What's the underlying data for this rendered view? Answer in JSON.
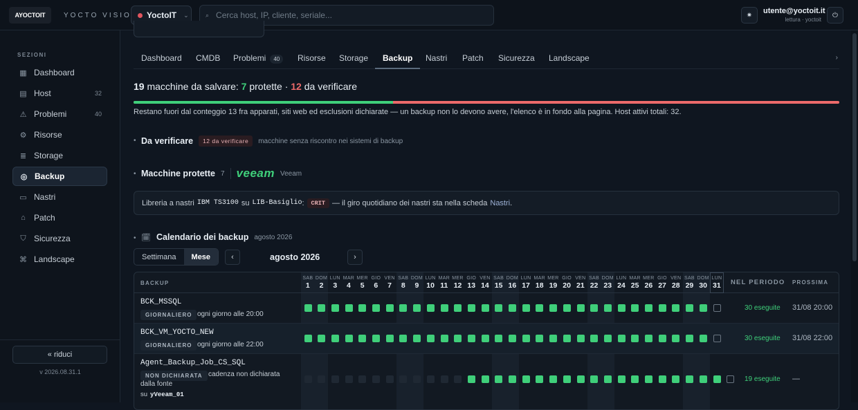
{
  "topbar": {
    "logo_text": "AYOCTOIT",
    "brand": "YOCTO VISION",
    "tenant": "YoctoIT",
    "search_placeholder": "Cerca host, IP, cliente, seriale...",
    "user_email": "utente@yoctoit.it",
    "user_role": "lettura · yoctoit"
  },
  "sidebar": {
    "section_label": "SEZIONI",
    "items": [
      {
        "label": "Dashboard",
        "icon": "grid-icon",
        "count": ""
      },
      {
        "label": "Host",
        "icon": "server-icon",
        "count": "32"
      },
      {
        "label": "Problemi",
        "icon": "warning-icon",
        "count": "40"
      },
      {
        "label": "Risorse",
        "icon": "cpu-icon",
        "count": ""
      },
      {
        "label": "Storage",
        "icon": "database-icon",
        "count": ""
      },
      {
        "label": "Backup",
        "icon": "backup-icon",
        "count": "",
        "active": true
      },
      {
        "label": "Nastri",
        "icon": "tape-icon",
        "count": ""
      },
      {
        "label": "Patch",
        "icon": "patch-icon",
        "count": ""
      },
      {
        "label": "Sicurezza",
        "icon": "shield-icon",
        "count": ""
      },
      {
        "label": "Landscape",
        "icon": "network-icon",
        "count": ""
      }
    ],
    "reduce_label": "« riduci",
    "version": "v 2026.08.31.1"
  },
  "tabs": [
    {
      "label": "Dashboard",
      "badge": ""
    },
    {
      "label": "CMDB",
      "badge": ""
    },
    {
      "label": "Problemi",
      "badge": "40"
    },
    {
      "label": "Risorse",
      "badge": ""
    },
    {
      "label": "Storage",
      "badge": ""
    },
    {
      "label": "Backup",
      "badge": "",
      "active": true
    },
    {
      "label": "Nastri",
      "badge": ""
    },
    {
      "label": "Patch",
      "badge": ""
    },
    {
      "label": "Sicurezza",
      "badge": ""
    },
    {
      "label": "Landscape",
      "badge": ""
    }
  ],
  "summary": {
    "to_save_count": "19",
    "to_save_text": "macchine da salvare:",
    "protected_count": "7",
    "protected_text": "protette ·",
    "verify_count": "12",
    "verify_text": "da verificare",
    "protected_fraction": 0.368,
    "note": "Restano fuori dal conteggio 13 fra apparati, siti web ed esclusioni dichiarate — un backup non lo devono avere, l'elenco è in fondo alla pagina. Host attivi totali: 32."
  },
  "verify_section": {
    "title": "Da verificare",
    "badge": "12 da verificare",
    "desc": "macchine senza riscontro nei sistemi di backup"
  },
  "protected_section": {
    "title": "Macchine protette",
    "count": "7",
    "vendor_logo": "veeam",
    "vendor": "Veeam"
  },
  "tape_info": {
    "prefix": "Libreria a nastri",
    "model": "IBM TS3100",
    "on": "su",
    "host": "LIB-Basiglio",
    "colon": ":",
    "status": "CRIT",
    "suffix": "— il giro quotidiano dei nastri sta nella scheda",
    "link": "Nastri",
    "end": "."
  },
  "calendar": {
    "title": "Calendario dei backup",
    "subtitle": "agosto 2026",
    "view_week": "Settimana",
    "view_month": "Mese",
    "prev": "‹",
    "next": "›",
    "month_label": "agosto 2026",
    "col_backup": "BACKUP",
    "col_period": "NEL PERIODO",
    "col_next": "PROSSIMA",
    "days": [
      {
        "d": "SAB",
        "n": "1"
      },
      {
        "d": "DOM",
        "n": "2"
      },
      {
        "d": "LUN",
        "n": "3"
      },
      {
        "d": "MAR",
        "n": "4"
      },
      {
        "d": "MER",
        "n": "5"
      },
      {
        "d": "GIO",
        "n": "6"
      },
      {
        "d": "VEN",
        "n": "7"
      },
      {
        "d": "SAB",
        "n": "8"
      },
      {
        "d": "DOM",
        "n": "9"
      },
      {
        "d": "LUN",
        "n": "10"
      },
      {
        "d": "MAR",
        "n": "11"
      },
      {
        "d": "MER",
        "n": "12"
      },
      {
        "d": "GIO",
        "n": "13"
      },
      {
        "d": "VEN",
        "n": "14"
      },
      {
        "d": "SAB",
        "n": "15"
      },
      {
        "d": "DOM",
        "n": "16"
      },
      {
        "d": "LUN",
        "n": "17"
      },
      {
        "d": "MAR",
        "n": "18"
      },
      {
        "d": "MER",
        "n": "19"
      },
      {
        "d": "GIO",
        "n": "20"
      },
      {
        "d": "VEN",
        "n": "21"
      },
      {
        "d": "SAB",
        "n": "22"
      },
      {
        "d": "DOM",
        "n": "23"
      },
      {
        "d": "LUN",
        "n": "24"
      },
      {
        "d": "MAR",
        "n": "25"
      },
      {
        "d": "MER",
        "n": "26"
      },
      {
        "d": "GIO",
        "n": "27"
      },
      {
        "d": "VEN",
        "n": "28"
      },
      {
        "d": "SAB",
        "n": "29"
      },
      {
        "d": "DOM",
        "n": "30"
      },
      {
        "d": "LUN",
        "n": "31"
      }
    ],
    "jobs": [
      {
        "name": "BCK_MSSQL",
        "tag": "GIORNALIERO",
        "schedule": "ogni giorno alle 20:00",
        "host_prefix": "",
        "host": "",
        "status": "oooooooooooooooooooooooooooooop",
        "period": "30 eseguite",
        "next": "31/08 20:00"
      },
      {
        "name": "BCK_VM_YOCTO_NEW",
        "tag": "GIORNALIERO",
        "schedule": "ogni giorno alle 22:00",
        "host_prefix": "",
        "host": "",
        "status": "oooooooooooooooooooooooooooooop",
        "period": "30 eseguite",
        "next": "31/08 22:00"
      },
      {
        "name": "Agent_Backup_Job_CS_SQL",
        "tag": "NON DICHIARATA",
        "schedule": "cadenza non dichiarata dalla fonte",
        "host_prefix": "su",
        "host": "yVeeam_01",
        "status": "------------ooooooooooooooooooop",
        "period": "19 eseguite",
        "next": "—"
      }
    ]
  }
}
